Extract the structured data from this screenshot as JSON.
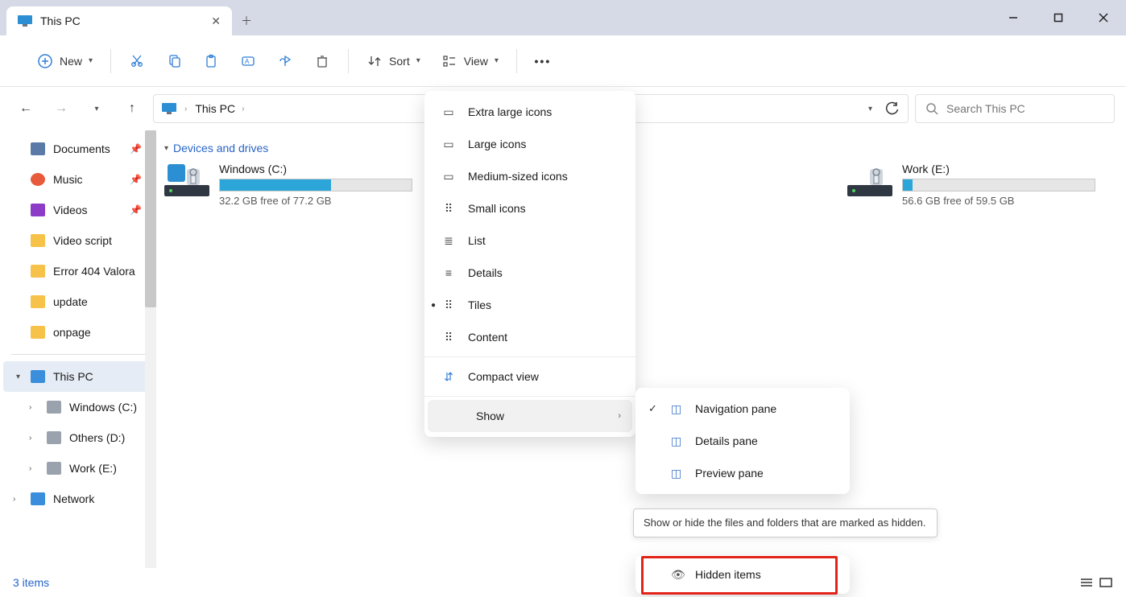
{
  "window": {
    "tab_title": "This PC",
    "new_tab_tooltip": "New tab"
  },
  "toolbar": {
    "new_label": "New",
    "sort_label": "Sort",
    "view_label": "View"
  },
  "breadcrumb": {
    "root": "This PC"
  },
  "search": {
    "placeholder": "Search This PC"
  },
  "sidebar": {
    "items": [
      {
        "label": "Documents",
        "icon": "docs",
        "pinned": true
      },
      {
        "label": "Music",
        "icon": "music",
        "pinned": true
      },
      {
        "label": "Videos",
        "icon": "videos",
        "pinned": true
      },
      {
        "label": "Video script",
        "icon": "folder"
      },
      {
        "label": "Error 404 Valora",
        "icon": "folder"
      },
      {
        "label": "update",
        "icon": "folder"
      },
      {
        "label": "onpage",
        "icon": "folder"
      }
    ],
    "this_pc": "This PC",
    "drives": [
      {
        "label": "Windows (C:)"
      },
      {
        "label": "Others (D:)"
      },
      {
        "label": "Work (E:)"
      }
    ],
    "network": "Network"
  },
  "content": {
    "group_header": "Devices and drives",
    "drives": [
      {
        "name": "Windows (C:)",
        "free_text": "32.2 GB free of 77.2 GB",
        "fill_pct": 58
      },
      {
        "name": "Work (E:)",
        "free_text": "56.6 GB free of 59.5 GB",
        "fill_pct": 5
      }
    ]
  },
  "statusbar": {
    "count_text": "3 items"
  },
  "view_menu": {
    "items": [
      "Extra large icons",
      "Large icons",
      "Medium-sized icons",
      "Small icons",
      "List",
      "Details",
      "Tiles",
      "Content"
    ],
    "selected_index": 6,
    "compact_view": "Compact view",
    "show": "Show"
  },
  "show_submenu": {
    "items": [
      {
        "label": "Navigation pane",
        "checked": true
      },
      {
        "label": "Details pane",
        "checked": false
      },
      {
        "label": "Preview pane",
        "checked": false
      }
    ],
    "hidden_items": "Hidden items"
  },
  "tooltip": {
    "text": "Show or hide the files and folders that are marked as hidden."
  }
}
